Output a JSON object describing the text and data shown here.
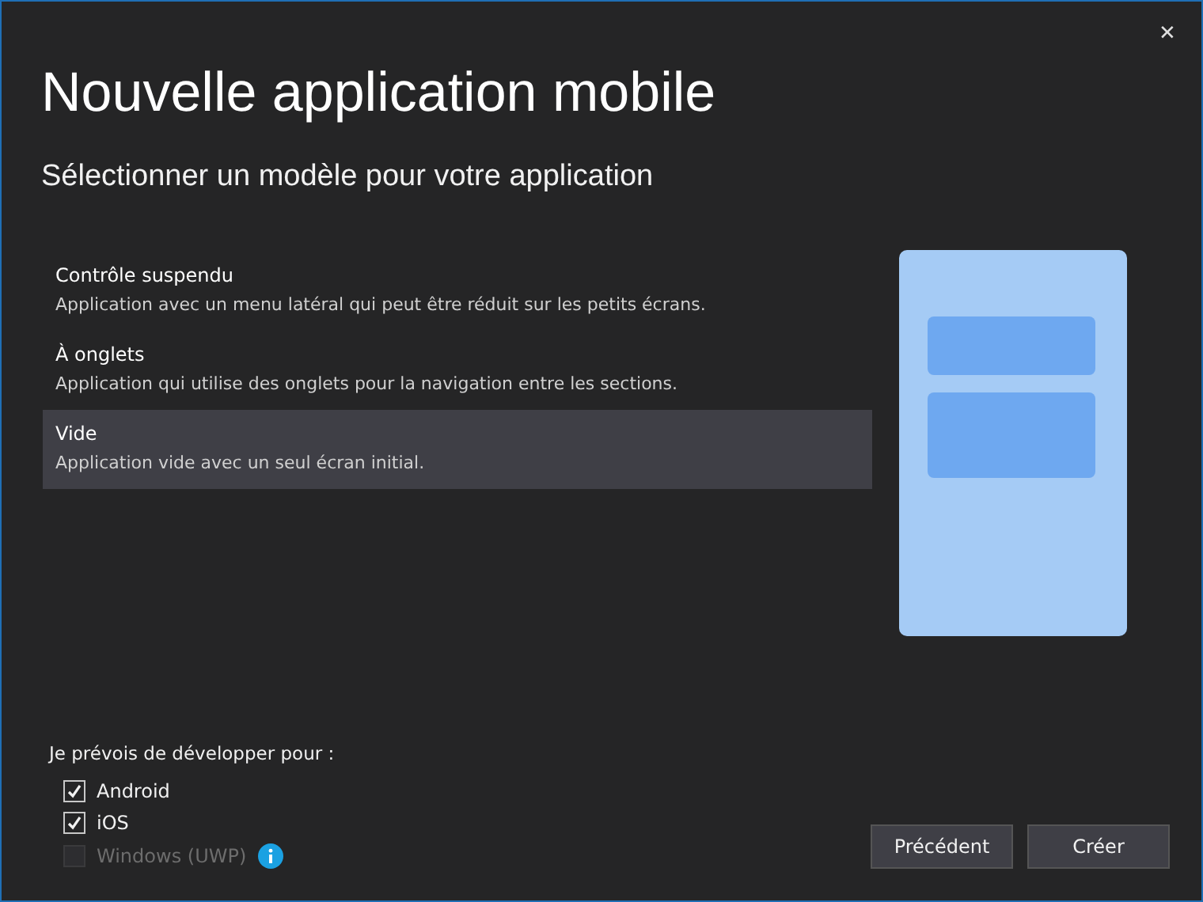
{
  "window": {
    "title": "Nouvelle application mobile",
    "close": "✕"
  },
  "subtitle": "Sélectionner un modèle pour votre application",
  "templates": [
    {
      "name": "Contrôle suspendu",
      "description": "Application avec un menu latéral qui peut être réduit sur les petits écrans.",
      "selected": false
    },
    {
      "name": "À onglets",
      "description": "Application qui utilise des onglets pour la navigation entre les sections.",
      "selected": false
    },
    {
      "name": "Vide",
      "description": "Application vide avec un seul écran initial.",
      "selected": true
    }
  ],
  "platforms": {
    "label": "Je prévois de développer pour :",
    "items": [
      {
        "label": "Android",
        "checked": true,
        "disabled": false,
        "info": false
      },
      {
        "label": "iOS",
        "checked": true,
        "disabled": false,
        "info": false
      },
      {
        "label": "Windows (UWP)",
        "checked": false,
        "disabled": true,
        "info": true
      }
    ]
  },
  "buttons": [
    {
      "label": "Précédent"
    },
    {
      "label": "Créer"
    }
  ]
}
